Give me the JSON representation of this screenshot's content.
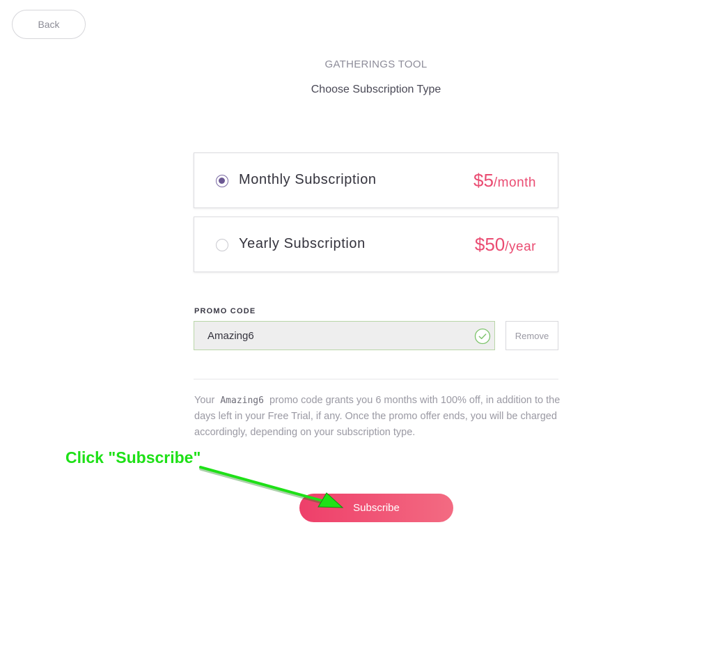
{
  "nav": {
    "back_label": "Back"
  },
  "header": {
    "app_title": "GATHERINGS TOOL",
    "subtitle": "Choose Subscription Type"
  },
  "plans": [
    {
      "name": "Monthly Subscription",
      "price": "$5",
      "unit": "/month",
      "selected": true
    },
    {
      "name": "Yearly Subscription",
      "price": "$50",
      "unit": "/year",
      "selected": false
    }
  ],
  "promo": {
    "label": "PROMO CODE",
    "value": "Amazing6",
    "status": "valid",
    "remove_label": "Remove",
    "info_before": "Your",
    "info_code": "Amazing6",
    "info_after": "promo code grants you 6 months with 100% off, in addition to the days left in your Free Trial, if any. Once the promo offer ends, you will be charged accordingly, depending on your subscription type."
  },
  "actions": {
    "subscribe_label": "Subscribe"
  },
  "annotation": {
    "text": "Click \"Subscribe\""
  },
  "colors": {
    "accent_pink": "#ea4c72",
    "radio_purple": "#6b5893",
    "success_green": "#7cc36a",
    "annotation_green": "#1ee017"
  }
}
